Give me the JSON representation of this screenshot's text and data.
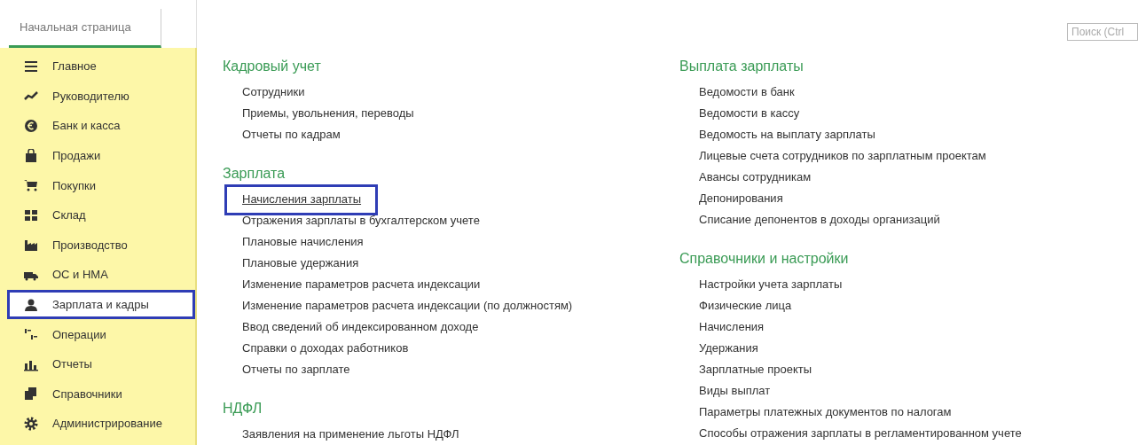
{
  "home_tab": {
    "label": "Начальная страница",
    "selected": true
  },
  "search": {
    "placeholder": "Поиск (Ctrl"
  },
  "sidebar": {
    "items": [
      {
        "label": "Главное",
        "selected": false
      },
      {
        "label": "Руководителю",
        "selected": false
      },
      {
        "label": "Банк и касса",
        "selected": false
      },
      {
        "label": "Продажи",
        "selected": false
      },
      {
        "label": "Покупки",
        "selected": false
      },
      {
        "label": "Склад",
        "selected": false
      },
      {
        "label": "Производство",
        "selected": false
      },
      {
        "label": "ОС и НМА",
        "selected": false
      },
      {
        "label": "Зарплата и кадры",
        "selected": true
      },
      {
        "label": "Операции",
        "selected": false
      },
      {
        "label": "Отчеты",
        "selected": false
      },
      {
        "label": "Справочники",
        "selected": false
      },
      {
        "label": "Администрирование",
        "selected": false
      }
    ]
  },
  "columns": [
    {
      "sections": [
        {
          "title": "Кадровый учет",
          "links": [
            {
              "label": "Сотрудники",
              "selected": false
            },
            {
              "label": "Приемы, увольнения, переводы",
              "selected": false
            },
            {
              "label": "Отчеты по кадрам",
              "selected": false
            }
          ]
        },
        {
          "title": "Зарплата",
          "links": [
            {
              "label": "Начисления зарплаты",
              "selected": true
            },
            {
              "label": "Отражения зарплаты в бухгалтерском учете",
              "selected": false
            },
            {
              "label": "Плановые начисления",
              "selected": false
            },
            {
              "label": "Плановые удержания",
              "selected": false
            },
            {
              "label": "Изменение параметров расчета индексации",
              "selected": false
            },
            {
              "label": "Изменение параметров расчета индексации (по должностям)",
              "selected": false
            },
            {
              "label": "Ввод сведений об индексированном доходе",
              "selected": false
            },
            {
              "label": "Справки о доходах работников",
              "selected": false
            },
            {
              "label": "Отчеты по зарплате",
              "selected": false
            }
          ]
        },
        {
          "title": "НДФЛ",
          "links": [
            {
              "label": "Заявления на применение льготы НДФЛ",
              "selected": false
            }
          ]
        }
      ]
    },
    {
      "sections": [
        {
          "title": "Выплата зарплаты",
          "links": [
            {
              "label": "Ведомости в банк",
              "selected": false
            },
            {
              "label": "Ведомости в кассу",
              "selected": false
            },
            {
              "label": "Ведомость на выплату зарплаты",
              "selected": false
            },
            {
              "label": "Лицевые счета сотрудников по зарплатным проектам",
              "selected": false
            },
            {
              "label": "Авансы сотрудникам",
              "selected": false
            },
            {
              "label": "Депонирования",
              "selected": false
            },
            {
              "label": "Списание депонентов в доходы организаций",
              "selected": false
            }
          ]
        },
        {
          "title": "Справочники и настройки",
          "links": [
            {
              "label": "Настройки учета зарплаты",
              "selected": false
            },
            {
              "label": "Физические лица",
              "selected": false
            },
            {
              "label": "Начисления",
              "selected": false
            },
            {
              "label": "Удержания",
              "selected": false
            },
            {
              "label": "Зарплатные проекты",
              "selected": false
            },
            {
              "label": "Виды выплат",
              "selected": false
            },
            {
              "label": "Параметры платежных документов по налогам",
              "selected": false
            },
            {
              "label": "Способы отражения зарплаты в регламентированном учете",
              "selected": false
            }
          ]
        }
      ]
    }
  ]
}
